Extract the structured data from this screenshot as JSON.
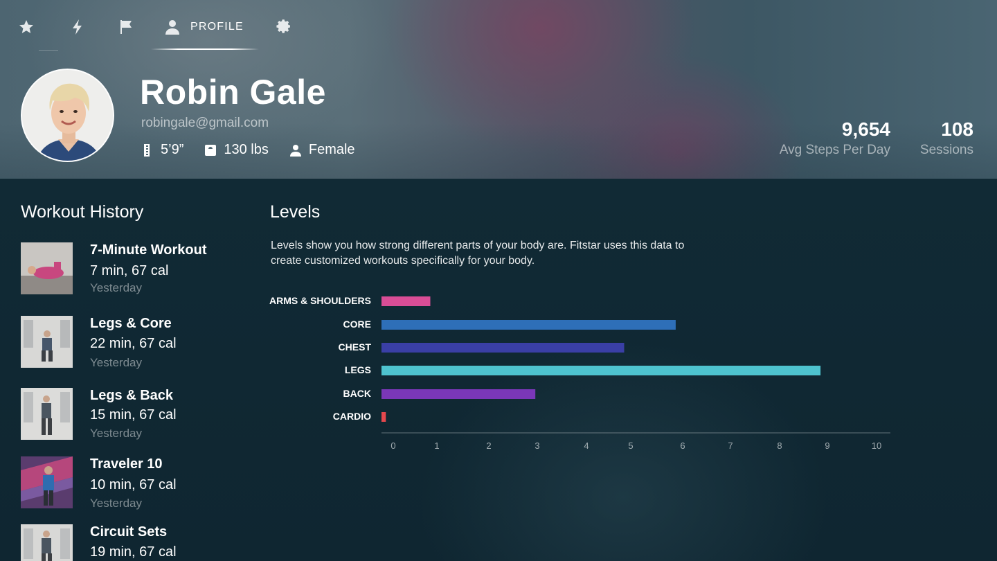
{
  "nav": {
    "items": [
      {
        "icon": "star-icon",
        "label": ""
      },
      {
        "icon": "bolt-icon",
        "label": ""
      },
      {
        "icon": "flag-icon",
        "label": ""
      },
      {
        "icon": "person-icon",
        "label": "PROFILE"
      },
      {
        "icon": "gear-icon",
        "label": ""
      }
    ],
    "active": "PROFILE"
  },
  "profile": {
    "name": "Robin Gale",
    "email": "robingale@gmail.com",
    "height": "5’9”",
    "weight": "130 lbs",
    "gender": "Female"
  },
  "metrics": {
    "steps_value": "9,654",
    "steps_label": "Avg Steps Per Day",
    "sessions_value": "108",
    "sessions_label": "Sessions"
  },
  "history": {
    "title": "Workout History",
    "items": [
      {
        "name": "7-Minute Workout",
        "meta": "7 min, 67 cal",
        "when": "Yesterday"
      },
      {
        "name": "Legs & Core",
        "meta": "22 min, 67 cal",
        "when": "Yesterday"
      },
      {
        "name": "Legs & Back",
        "meta": "15 min, 67 cal",
        "when": "Yesterday"
      },
      {
        "name": "Traveler 10",
        "meta": "10 min, 67 cal",
        "when": "Yesterday"
      },
      {
        "name": "Circuit Sets",
        "meta": "19 min, 67 cal",
        "when": ""
      }
    ]
  },
  "levels": {
    "title": "Levels",
    "description": "Levels show you how strong different parts of your body are. Fitstar uses this data to create customized workouts specifically for your body."
  },
  "chart_data": {
    "type": "bar",
    "orientation": "horizontal",
    "categories": [
      "ARMS & SHOULDERS",
      "CORE",
      "CHEST",
      "LEGS",
      "BACK",
      "CARDIO"
    ],
    "values": [
      1.1,
      6.1,
      5.1,
      9.1,
      3.2,
      0.1
    ],
    "colors": [
      "#d94d96",
      "#2e6fb8",
      "#3a3fa6",
      "#4ec3cf",
      "#7a37b8",
      "#e5484d"
    ],
    "xticks": [
      0,
      1,
      2,
      3,
      4,
      5,
      6,
      7,
      8,
      9,
      10
    ],
    "xlim": [
      0,
      10
    ],
    "title": "",
    "xlabel": "",
    "ylabel": "",
    "grid": false
  }
}
